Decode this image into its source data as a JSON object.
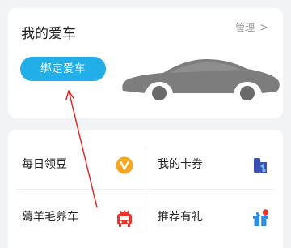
{
  "car_card": {
    "title": "我的爱车",
    "manage_label": "管理",
    "manage_chevron": ">",
    "bind_button_label": "绑定爱车",
    "car_image": "car-silhouette"
  },
  "services": [
    {
      "label": "每日领豆",
      "icon": "bean-coin-icon",
      "color": "#f5a623"
    },
    {
      "label": "我的卡券",
      "icon": "coupon-icon",
      "color": "#3b4fb5"
    },
    {
      "label": "薅羊毛养车",
      "icon": "car-gift-icon",
      "color": "#e8362f"
    },
    {
      "label": "推荐有礼",
      "icon": "gift-box-icon",
      "color": "#2f8ee0"
    }
  ],
  "colors": {
    "accent": "#22aee6",
    "background": "#f2f3f5",
    "annotation_arrow": "#e02020"
  }
}
